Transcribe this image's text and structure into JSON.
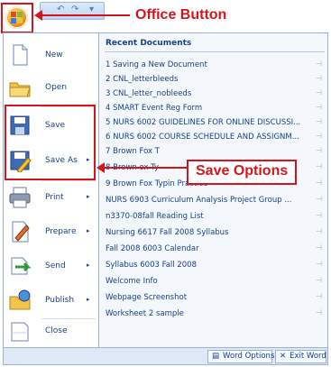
{
  "annotations": {
    "office_button": "Office Button",
    "save_options": "Save Options"
  },
  "qat": {
    "undo": "↶",
    "redo": "↷",
    "dropdown": "▾"
  },
  "menu": {
    "left": [
      {
        "label": "New",
        "has_sub": false
      },
      {
        "label": "Open",
        "has_sub": false
      },
      {
        "label": "Save",
        "has_sub": false
      },
      {
        "label": "Save As",
        "has_sub": true
      },
      {
        "label": "Print",
        "has_sub": true
      },
      {
        "label": "Prepare",
        "has_sub": true
      },
      {
        "label": "Send",
        "has_sub": true
      },
      {
        "label": "Publish",
        "has_sub": true
      },
      {
        "label": "Close",
        "has_sub": false
      }
    ],
    "submenu_glyph": "▸",
    "recent_title": "Recent Documents",
    "recent": [
      "1  Saving a New Document",
      "2  CNL_letterbleeds",
      "3  CNL_letter_nobleeds",
      "4  SMART Event Reg Form",
      "5  NURS 6002 GUIDELINES FOR ONLINE DISCUSSI...",
      "6  NURS 6002 COURSE SCHEDULE AND ASSIGNM...",
      "7  Brown Fox T",
      "8  Brown ox Ty",
      "9  Brown Fox Typin Practice",
      "NURS 6903 Curriculum Analysis Project Group ...",
      "n3370-08fall Reading List",
      "Nursing 6617 Fall 2008 Syllabus",
      "Fall 2008 6003 Calendar",
      "Syllabus 6003 Fall 2008",
      "Welcome Info",
      "Webpage Screenshot",
      "Worksheet 2 sample"
    ],
    "pin_glyph": "⊣"
  },
  "footer": {
    "word_options": "Word Options",
    "exit_word": "Exit Word"
  }
}
